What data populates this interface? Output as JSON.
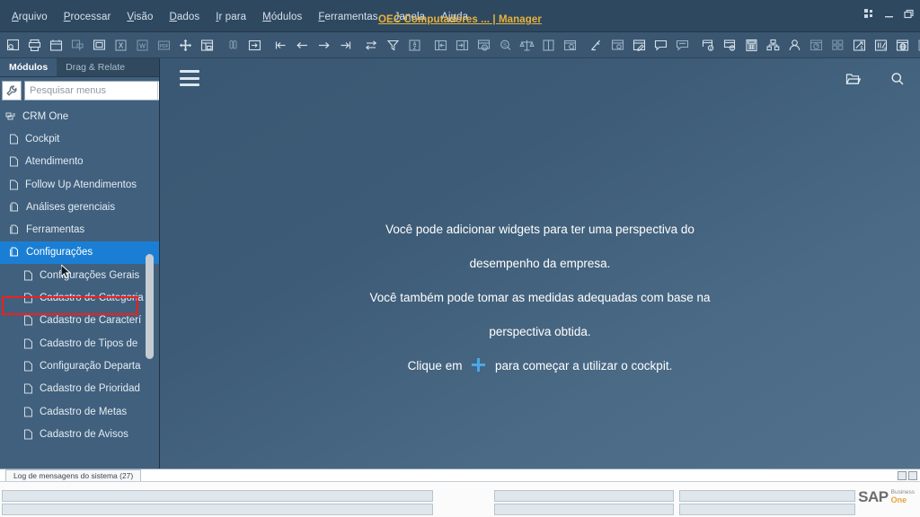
{
  "window": {
    "title": "OEC Computadores ... | Manager",
    "controls": [
      "grid-icon",
      "minimize-icon",
      "restore-icon"
    ]
  },
  "menubar": {
    "items": [
      {
        "label": "Arquivo",
        "accel": "A"
      },
      {
        "label": "Processar",
        "accel": "P"
      },
      {
        "label": "Visão",
        "accel": "V"
      },
      {
        "label": "Dados",
        "accel": "D"
      },
      {
        "label": "Ir para",
        "accel": "I"
      },
      {
        "label": "Módulos",
        "accel": "M"
      },
      {
        "label": "Ferramentas",
        "accel": "F"
      },
      {
        "label": "Janela",
        "accel": "J"
      },
      {
        "label": "Ajuda",
        "accel": "u"
      }
    ]
  },
  "toolbar": {
    "groups": [
      [
        "preview-icon",
        "print-icon",
        "print-layout-icon",
        "email-icon",
        "window-icon",
        "export-excel-icon",
        "export-word-icon",
        "export-pdf-icon",
        "launch-app-icon",
        "lock-screen-icon"
      ],
      [
        "find-icon",
        "next-record-icon"
      ],
      [
        "first-record-icon",
        "previous-record-icon",
        "next-record-arrow-icon",
        "last-record-icon"
      ],
      [
        "transfer-icon",
        "filter-icon",
        "sort-icon"
      ],
      [
        "add-row-icon",
        "duplicate-row-icon",
        "restore-column-icon",
        "find-amount-icon",
        "balance-icon",
        "split-view-icon",
        "query-icon"
      ],
      [
        "edit-icon",
        "settings-form-icon",
        "user-defined-fields-icon",
        "messages-icon",
        "sent-messages-icon"
      ],
      [
        "alert-icon",
        "alert-window-icon",
        "calculator-icon",
        "org-chart-icon",
        "user-icon",
        "dashboard-icon",
        "widgets-icon",
        "sales-opportunity-icon",
        "approvals-icon",
        "browser-icon",
        "help-icon"
      ]
    ]
  },
  "sidebar": {
    "tabs": [
      {
        "label": "Módulos",
        "active": true
      },
      {
        "label": "Drag & Relate",
        "active": false
      }
    ],
    "wrench_icon": "wrench-icon",
    "search": {
      "placeholder": "Pesquisar menus",
      "value": "",
      "button_icon": "search-icon"
    },
    "tree": [
      {
        "label": "CRM One",
        "level": 0,
        "icon": "module-root-icon",
        "selected": false
      },
      {
        "label": "Cockpit",
        "level": 1,
        "icon": "page-icon",
        "selected": false
      },
      {
        "label": "Atendimento",
        "level": 1,
        "icon": "page-icon",
        "selected": false
      },
      {
        "label": "Follow Up Atendimentos",
        "level": 1,
        "icon": "page-icon",
        "selected": false
      },
      {
        "label": "Análises gerenciais",
        "level": 1,
        "icon": "folder-icon",
        "selected": false
      },
      {
        "label": "Ferramentas",
        "level": 1,
        "icon": "folder-icon",
        "selected": false
      },
      {
        "label": "Configurações",
        "level": 1,
        "icon": "folder-icon",
        "selected": true
      },
      {
        "label": "Configurações Gerais",
        "level": 2,
        "icon": "page-icon",
        "selected": false
      },
      {
        "label": "Cadastro de Categoria",
        "level": 2,
        "icon": "page-icon",
        "selected": false
      },
      {
        "label": "Cadastro de Caracterí",
        "level": 2,
        "icon": "page-icon",
        "selected": false
      },
      {
        "label": "Cadastro de Tipos de ",
        "level": 2,
        "icon": "page-icon",
        "selected": false
      },
      {
        "label": "Configuração Departa",
        "level": 2,
        "icon": "page-icon",
        "selected": false
      },
      {
        "label": "Cadastro de Prioridad",
        "level": 2,
        "icon": "page-icon",
        "selected": false
      },
      {
        "label": "Cadastro de Metas",
        "level": 2,
        "icon": "page-icon",
        "selected": false
      },
      {
        "label": "Cadastro de Avisos",
        "level": 2,
        "icon": "page-icon",
        "selected": false
      }
    ]
  },
  "main": {
    "menu_icon": "hamburger-icon",
    "header_icons": [
      "open-folder-icon",
      "search-icon"
    ],
    "empty_state": {
      "line1": "Você pode adicionar widgets para ter uma perspectiva do",
      "line2": "desempenho da empresa.",
      "line3": "Você também pode tomar as medidas adequadas com base na",
      "line4": "perspectiva obtida.",
      "line5_before": "Clique em",
      "line5_after": "para começar a utilizar o cockpit.",
      "plus_icon": "plus-icon",
      "plus_color": "#49a9e8"
    }
  },
  "status": {
    "log_tab": "Log de mensagens do sistema (27)",
    "brand": {
      "word": "SAP",
      "sub_top": "Business",
      "sub_bottom": "One"
    }
  },
  "colors": {
    "titlebar": "#2e4860",
    "toolbar": "#3a5670",
    "sidebar": "#41607d",
    "selection": "#1a7fd4",
    "highlight_border": "#f21f1f",
    "title_text": "#e8b23c",
    "accent_plus": "#49a9e8"
  }
}
